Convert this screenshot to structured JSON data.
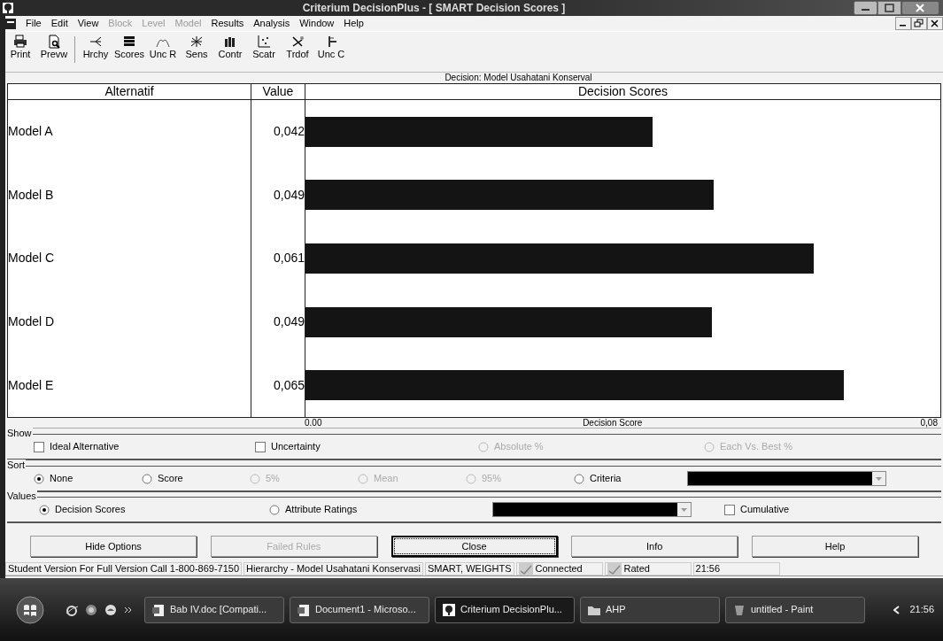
{
  "window": {
    "title": "Criterium DecisionPlus - [ SMART Decision Scores ]"
  },
  "menu": [
    {
      "label": "File",
      "disabled": false
    },
    {
      "label": "Edit",
      "disabled": false
    },
    {
      "label": "View",
      "disabled": false
    },
    {
      "label": "Block",
      "disabled": true
    },
    {
      "label": "Level",
      "disabled": true
    },
    {
      "label": "Model",
      "disabled": true
    },
    {
      "label": "Results",
      "disabled": false
    },
    {
      "label": "Analysis",
      "disabled": false
    },
    {
      "label": "Window",
      "disabled": false
    },
    {
      "label": "Help",
      "disabled": false
    }
  ],
  "toolbar": [
    {
      "label": "Print"
    },
    {
      "label": "Prevw"
    },
    {
      "label": "Hrchy"
    },
    {
      "label": "Scores"
    },
    {
      "label": "Unc R"
    },
    {
      "label": "Sens"
    },
    {
      "label": "Contr"
    },
    {
      "label": "Scatr"
    },
    {
      "label": "Trdof"
    },
    {
      "label": "Unc C"
    }
  ],
  "decision_label": "Decision: Model Usahatani Konserval",
  "table": {
    "columns": [
      "Alternatif",
      "Value",
      "Decision Scores"
    ],
    "rows": [
      {
        "alternatif": "Model A",
        "value": "0,042"
      },
      {
        "alternatif": "Model B",
        "value": "0,049"
      },
      {
        "alternatif": "Model C",
        "value": "0,061"
      },
      {
        "alternatif": "Model D",
        "value": "0,049"
      },
      {
        "alternatif": "Model E",
        "value": "0,065"
      }
    ],
    "axis": {
      "start": "0.00",
      "label": "Decision Score",
      "end": "0,08"
    }
  },
  "groups": [
    {
      "title": "Show",
      "items": [
        {
          "kind": "checkbox",
          "label": "Ideal Alternative",
          "checked": false,
          "disabled": false
        },
        {
          "kind": "checkbox",
          "label": "Uncertainty",
          "checked": false,
          "disabled": false
        },
        {
          "kind": "radio",
          "label": "Absolute %",
          "selected": false,
          "disabled": true
        },
        {
          "kind": "radio",
          "label": "Each Vs. Best %",
          "selected": false,
          "disabled": true
        }
      ]
    },
    {
      "title": "Sort",
      "items": [
        {
          "kind": "radio",
          "label": "None",
          "selected": true,
          "disabled": false
        },
        {
          "kind": "radio",
          "label": "Score",
          "selected": false,
          "disabled": false
        },
        {
          "kind": "radio",
          "label": "5%",
          "selected": false,
          "disabled": true
        },
        {
          "kind": "radio",
          "label": "Mean",
          "selected": false,
          "disabled": true
        },
        {
          "kind": "radio",
          "label": "95%",
          "selected": false,
          "disabled": true
        },
        {
          "kind": "radio",
          "label": "Criteria",
          "selected": false,
          "disabled": false
        },
        {
          "kind": "dropdown"
        }
      ]
    },
    {
      "title": "Values",
      "items": [
        {
          "kind": "radio",
          "label": "Decision Scores",
          "selected": true,
          "disabled": false
        },
        {
          "kind": "radio",
          "label": "Attribute Ratings",
          "selected": false,
          "disabled": false
        },
        {
          "kind": "dropdown"
        },
        {
          "kind": "checkbox",
          "label": "Cumulative",
          "checked": false,
          "disabled": false
        }
      ]
    }
  ],
  "buttons": [
    {
      "label": "Hide Options",
      "disabled": false,
      "focused": false
    },
    {
      "label": "Failed Rules",
      "disabled": true,
      "focused": false
    },
    {
      "label": "Close",
      "disabled": false,
      "focused": true
    },
    {
      "label": "Info",
      "disabled": false,
      "focused": false
    },
    {
      "label": "Help",
      "disabled": false,
      "focused": false
    }
  ],
  "status_bar": [
    {
      "kind": "text",
      "text": "Student Version For Full Version Call 1-800-869-7150"
    },
    {
      "kind": "text",
      "text": "Hierarchy - Model Usahatani Konservasi"
    },
    {
      "kind": "text",
      "text": "SMART, WEIGHTS"
    },
    {
      "kind": "check",
      "text": "Connected"
    },
    {
      "kind": "check",
      "text": "Rated"
    },
    {
      "kind": "text",
      "text": "21:56"
    }
  ],
  "taskbar": {
    "items": [
      {
        "label": "Bab  IV.doc [Compati...",
        "kind": "doc",
        "active": false
      },
      {
        "label": "Document1 - Microso...",
        "kind": "doc",
        "active": false
      },
      {
        "label": "Criterium DecisionPlu...",
        "kind": "app",
        "active": true
      },
      {
        "label": "AHP",
        "kind": "folder",
        "active": false
      },
      {
        "label": "untitled - Paint",
        "kind": "paint",
        "active": false
      }
    ],
    "clock": "21:56"
  }
}
